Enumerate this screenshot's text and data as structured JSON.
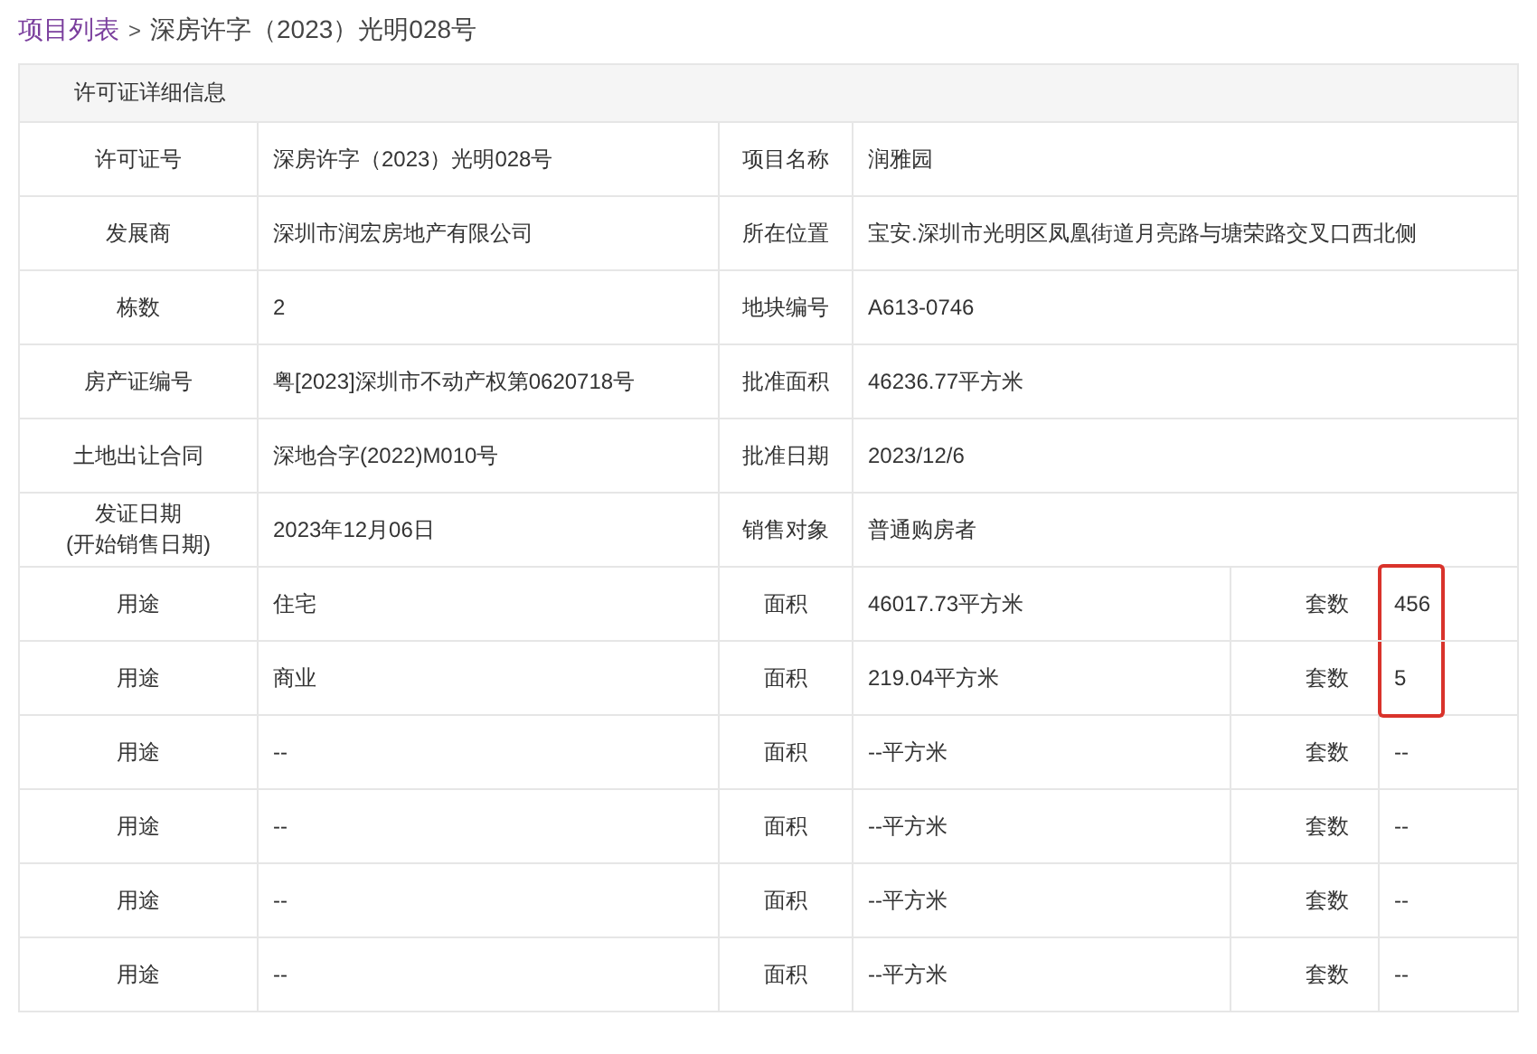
{
  "breadcrumb": {
    "link": "项目列表",
    "separator": ">",
    "current": "深房许字（2023）光明028号"
  },
  "panel": {
    "title": "许可证详细信息",
    "fields": [
      {
        "label": "许可证号",
        "value": "深房许字（2023）光明028号",
        "label_2": "项目名称",
        "value_2": "润雅园"
      },
      {
        "label": "发展商",
        "value": "深圳市润宏房地产有限公司",
        "label_2": "所在位置",
        "value_2": "宝安.深圳市光明区凤凰街道月亮路与塘荣路交叉口西北侧"
      },
      {
        "label": "栋数",
        "value": "2",
        "label_2": "地块编号",
        "value_2": "A613-0746"
      },
      {
        "label": "房产证编号",
        "value": "粤[2023]深圳市不动产权第0620718号",
        "label_2": "批准面积",
        "value_2": "46236.77平方米"
      },
      {
        "label": "土地出让合同",
        "value": "深地合字(2022)M010号",
        "label_2": "批准日期",
        "value_2": "2023/12/6"
      },
      {
        "label": "发证日期",
        "label_sub": "(开始销售日期)",
        "value": "2023年12月06日",
        "label_2": "销售对象",
        "value_2": "普通购房者"
      }
    ],
    "usages": [
      {
        "label": "用途",
        "value": "住宅",
        "area_label": "面积",
        "area": "46017.73平方米",
        "count_label": "套数",
        "count": "456",
        "highlighted": true
      },
      {
        "label": "用途",
        "value": "商业",
        "area_label": "面积",
        "area": "219.04平方米",
        "count_label": "套数",
        "count": "5",
        "highlighted": true
      },
      {
        "label": "用途",
        "value": "--",
        "area_label": "面积",
        "area": "--平方米",
        "count_label": "套数",
        "count": "--",
        "highlighted": false
      },
      {
        "label": "用途",
        "value": "--",
        "area_label": "面积",
        "area": "--平方米",
        "count_label": "套数",
        "count": "--",
        "highlighted": false
      },
      {
        "label": "用途",
        "value": "--",
        "area_label": "面积",
        "area": "--平方米",
        "count_label": "套数",
        "count": "--",
        "highlighted": false
      },
      {
        "label": "用途",
        "value": "--",
        "area_label": "面积",
        "area": "--平方米",
        "count_label": "套数",
        "count": "--",
        "highlighted": false
      }
    ]
  }
}
